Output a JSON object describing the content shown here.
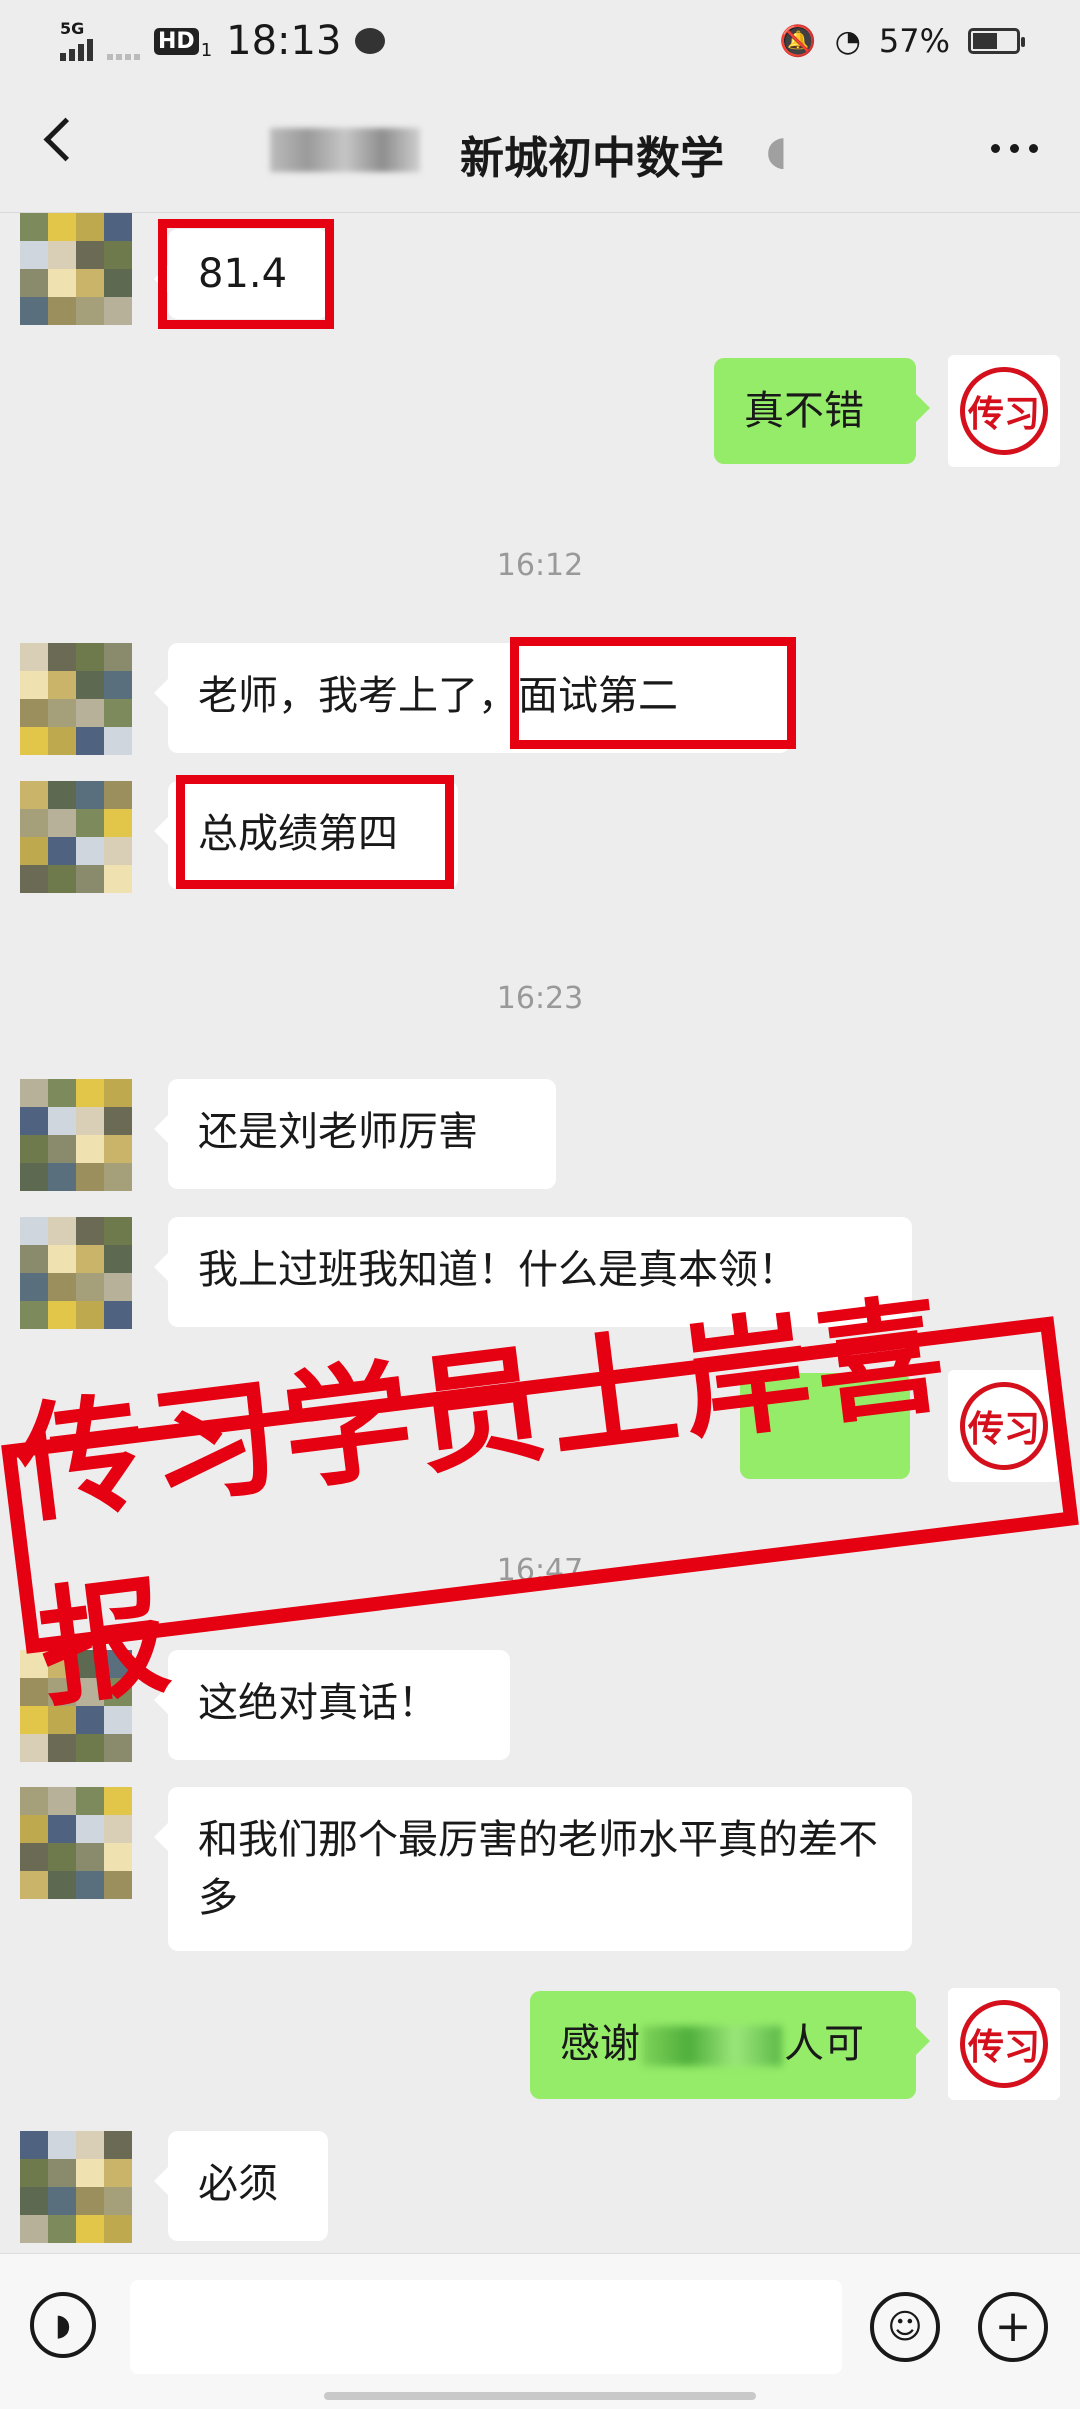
{
  "status_bar": {
    "network_label": "5G",
    "hd_label": "HD",
    "sim_label": "1",
    "time": "18:13",
    "battery": "57%",
    "battery_level": 0.57,
    "icons": [
      "signal-icon",
      "message-icon",
      "mute-icon",
      "wifi-icon",
      "battery-icon"
    ]
  },
  "nav": {
    "title": "新城初中数学",
    "icons": [
      "back-icon",
      "ear-icon",
      "more-icon"
    ]
  },
  "messages": [
    {
      "side": "left",
      "text": "81.4",
      "highlighted": true
    },
    {
      "side": "right",
      "text": "真不错"
    },
    {
      "type": "time",
      "text": "16:12"
    },
    {
      "side": "left",
      "text": "老师，我考上了，面试第二",
      "highlight_part": "面试第二"
    },
    {
      "side": "left",
      "text": "总成绩第四",
      "highlighted": true
    },
    {
      "type": "time",
      "text": "16:23"
    },
    {
      "side": "left",
      "text": "还是刘老师厉害"
    },
    {
      "side": "left",
      "text": "我上过班我知道！什么是真本领！"
    },
    {
      "type": "time",
      "text": "16:47"
    },
    {
      "side": "left",
      "text": "这绝对真话！"
    },
    {
      "side": "left",
      "text": "和我们那个最厉害的老师水平真的差不多"
    },
    {
      "side": "right",
      "text_before": "感谢",
      "text_after": "人可"
    },
    {
      "side": "left",
      "text": "必须"
    }
  ],
  "my_avatar_seal": "传习",
  "banner": {
    "text": "传习学员上岸喜报",
    "color": "#e50012"
  },
  "input_bar": {
    "icons": [
      "voice-icon",
      "emoji-icon",
      "plus-icon"
    ]
  },
  "colors": {
    "background": "#ededed",
    "my_bubble": "#95ec69",
    "highlight": "#e50012"
  }
}
